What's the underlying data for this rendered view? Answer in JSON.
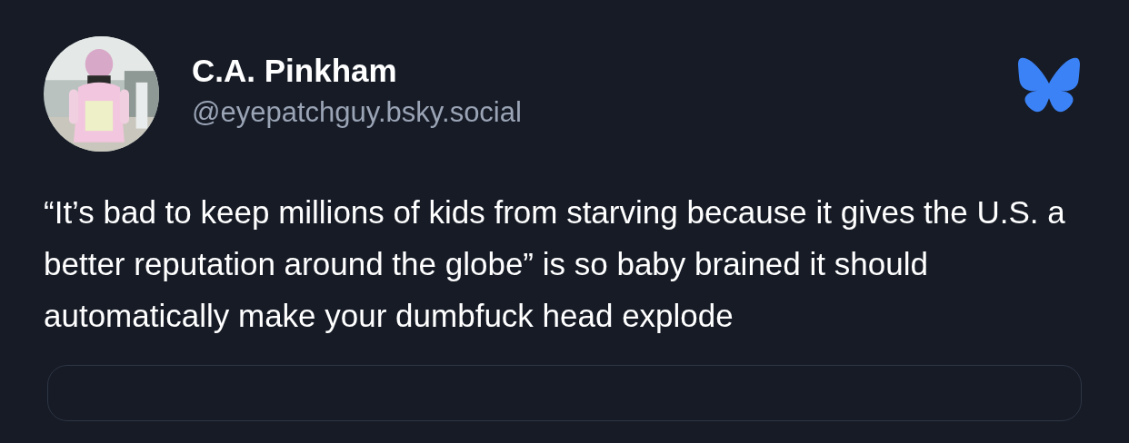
{
  "post": {
    "author": {
      "name": "C.A. Pinkham",
      "handle": "@eyepatchguy.bsky.social"
    },
    "text": "“It’s bad to keep millions of kids from starving because it gives the U.S. a better reputation around the globe” is so baby brained it should automatically make your dumbfuck head explode"
  }
}
